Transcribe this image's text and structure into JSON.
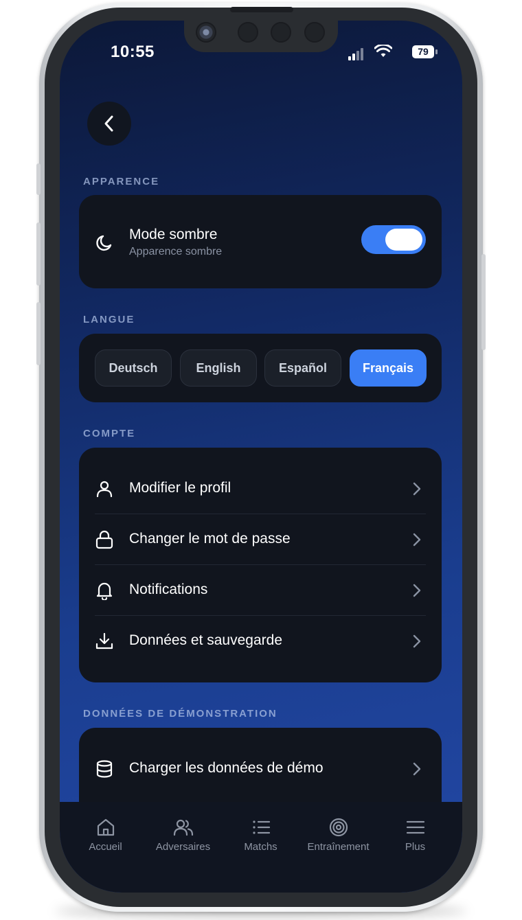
{
  "status_bar": {
    "time": "10:55",
    "battery": "79"
  },
  "sections": {
    "appearance": "APPARENCE",
    "language": "LANGUE",
    "account": "COMPTE",
    "demo": "DONNÉES DE DÉMONSTRATION"
  },
  "dark_mode": {
    "title": "Mode sombre",
    "subtitle": "Apparence sombre",
    "enabled": true
  },
  "languages": [
    {
      "label": "Deutsch",
      "selected": false
    },
    {
      "label": "English",
      "selected": false
    },
    {
      "label": "Español",
      "selected": false
    },
    {
      "label": "Français",
      "selected": true
    }
  ],
  "account_items": [
    {
      "label": "Modifier le profil",
      "icon": "user-icon"
    },
    {
      "label": "Changer le mot de passe",
      "icon": "lock-icon"
    },
    {
      "label": "Notifications",
      "icon": "bell-icon"
    },
    {
      "label": "Données et sauvegarde",
      "icon": "download-icon"
    }
  ],
  "demo_items": [
    {
      "label": "Charger les données de démo",
      "icon": "database-icon"
    }
  ],
  "tabs": [
    {
      "label": "Accueil",
      "icon": "home-icon"
    },
    {
      "label": "Adversaires",
      "icon": "users-icon"
    },
    {
      "label": "Matchs",
      "icon": "list-icon"
    },
    {
      "label": "Entraînement",
      "icon": "target-icon"
    },
    {
      "label": "Plus",
      "icon": "menu-icon"
    }
  ],
  "colors": {
    "accent": "#3a7ef5",
    "card": "#11151e",
    "tabbar": "#101521"
  }
}
